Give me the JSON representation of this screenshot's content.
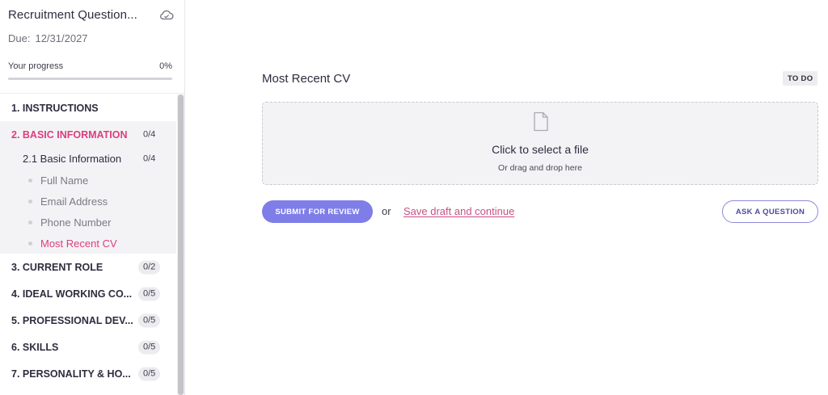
{
  "sidebar": {
    "title": "Recruitment Question...",
    "due_label": "Due:",
    "due_date": "12/31/2027",
    "progress_label": "Your progress",
    "progress_text": "0%",
    "progress_value": 0,
    "sections": [
      {
        "label": "1. INSTRUCTIONS",
        "badge": ""
      },
      {
        "label": "2. BASIC INFORMATION",
        "badge": "0/4"
      },
      {
        "label": "3. CURRENT ROLE",
        "badge": "0/2"
      },
      {
        "label": "4. IDEAL WORKING CO...",
        "badge": "0/5"
      },
      {
        "label": "5. PROFESSIONAL DEV...",
        "badge": "0/5"
      },
      {
        "label": "6. SKILLS",
        "badge": "0/5"
      },
      {
        "label": "7. PERSONALITY & HO...",
        "badge": "0/5"
      }
    ],
    "subsection": {
      "label": "2.1 Basic Information",
      "badge": "0/4"
    },
    "questions": [
      "Full Name",
      "Email Address",
      "Phone Number",
      "Most Recent CV"
    ]
  },
  "main": {
    "question_title": "Most Recent CV",
    "status_badge": "TO DO",
    "dropzone_title": "Click to select a file",
    "dropzone_subtitle": "Or drag and drop here",
    "submit_label": "SUBMIT FOR REVIEW",
    "or_text": "or",
    "save_link": "Save draft and continue",
    "ask_label": "ASK A QUESTION"
  },
  "colors": {
    "accent": "#7f7ee8",
    "active_pink": "#dc3e7c"
  }
}
